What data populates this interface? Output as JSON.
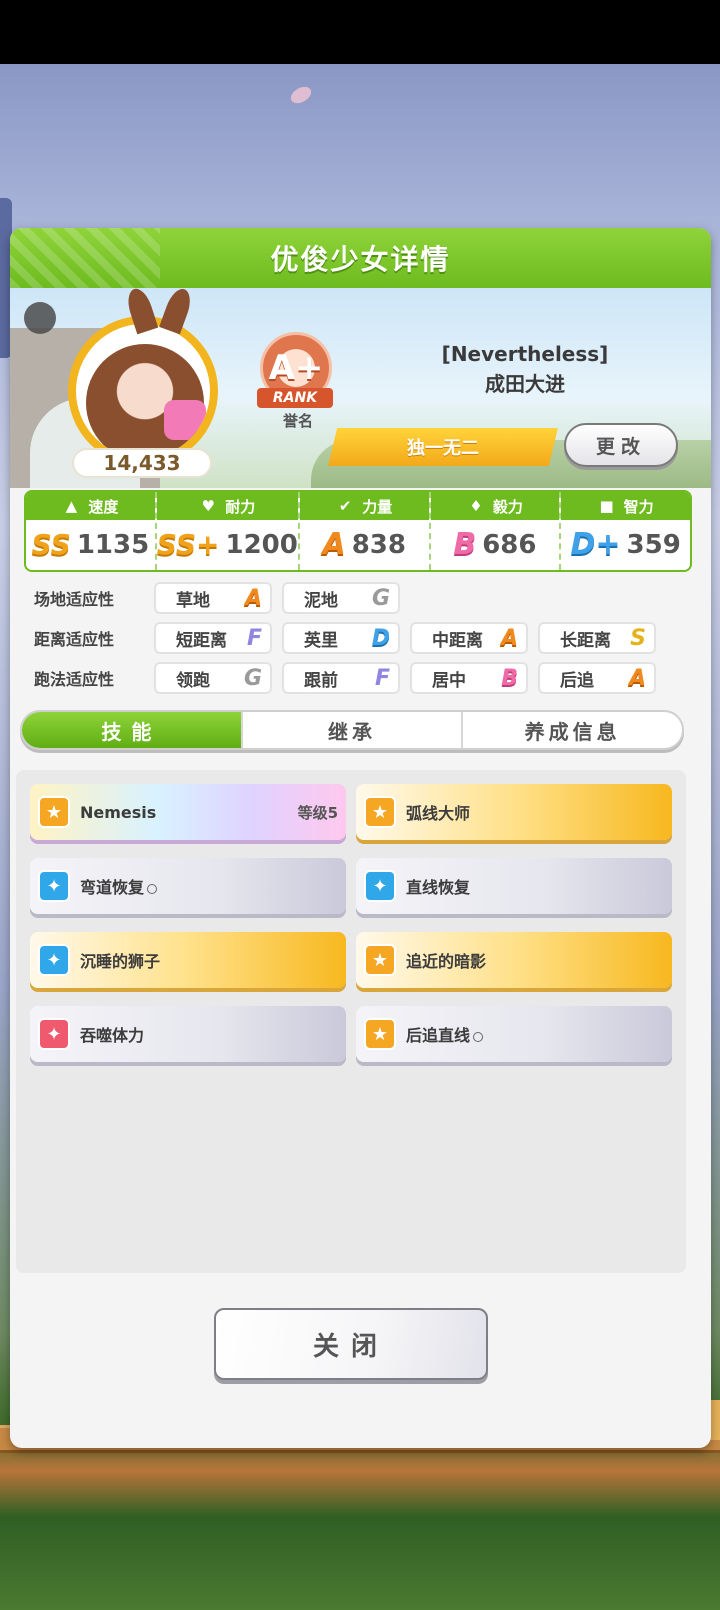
{
  "dialog": {
    "title": "优俊少女详情"
  },
  "profile": {
    "fan_count": "14,433",
    "rank": {
      "grade": "A+",
      "word": "RANK",
      "caption": "誉名"
    },
    "epithet": "[Nevertheless]",
    "name": "成田大进",
    "title_banner": "独一无二",
    "change_label": "更改"
  },
  "stats": [
    {
      "label": "速度",
      "icon": "shoe-icon",
      "grade": "SS",
      "value": "1135"
    },
    {
      "label": "耐力",
      "icon": "heart-icon",
      "grade": "SS+",
      "value": "1200"
    },
    {
      "label": "力量",
      "icon": "muscle-icon",
      "grade": "A",
      "value": "838"
    },
    {
      "label": "毅力",
      "icon": "flame-icon",
      "grade": "B",
      "value": "686"
    },
    {
      "label": "智力",
      "icon": "graduation-cap-icon",
      "grade": "D+",
      "value": "359"
    }
  ],
  "aptitudes": {
    "surface": {
      "label": "场地适应性",
      "items": [
        {
          "name": "草地",
          "grade": "A"
        },
        {
          "name": "泥地",
          "grade": "G"
        }
      ]
    },
    "distance": {
      "label": "距离适应性",
      "items": [
        {
          "name": "短距离",
          "grade": "F"
        },
        {
          "name": "英里",
          "grade": "D"
        },
        {
          "name": "中距离",
          "grade": "A"
        },
        {
          "name": "长距离",
          "grade": "S"
        }
      ]
    },
    "strategy": {
      "label": "跑法适应性",
      "items": [
        {
          "name": "领跑",
          "grade": "G"
        },
        {
          "name": "跟前",
          "grade": "F"
        },
        {
          "name": "居中",
          "grade": "B"
        },
        {
          "name": "后追",
          "grade": "A"
        }
      ]
    }
  },
  "tabs": [
    {
      "label": "技能"
    },
    {
      "label": "继承"
    },
    {
      "label": "养成信息"
    }
  ],
  "skills": [
    {
      "name": "Nemesis",
      "level": "等级5",
      "style": "rainbow",
      "icon": "orange"
    },
    {
      "name": "弧线大师",
      "style": "gold",
      "icon": "orange"
    },
    {
      "name": "弯道恢复",
      "style": "white",
      "icon": "blue",
      "mark": "○"
    },
    {
      "name": "直线恢复",
      "style": "white",
      "icon": "blue"
    },
    {
      "name": "沉睡的狮子",
      "style": "gold",
      "icon": "blue"
    },
    {
      "name": "追近的暗影",
      "style": "gold",
      "icon": "orange"
    },
    {
      "name": "吞噬体力",
      "style": "white",
      "icon": "red"
    },
    {
      "name": "后追直线",
      "style": "white",
      "icon": "orange",
      "mark": "○"
    }
  ],
  "close_label": "关闭",
  "colors": {
    "header_green": "#6dbb1f",
    "grade_gold": "#f0a21b",
    "title_banner": "#f3a81a"
  }
}
